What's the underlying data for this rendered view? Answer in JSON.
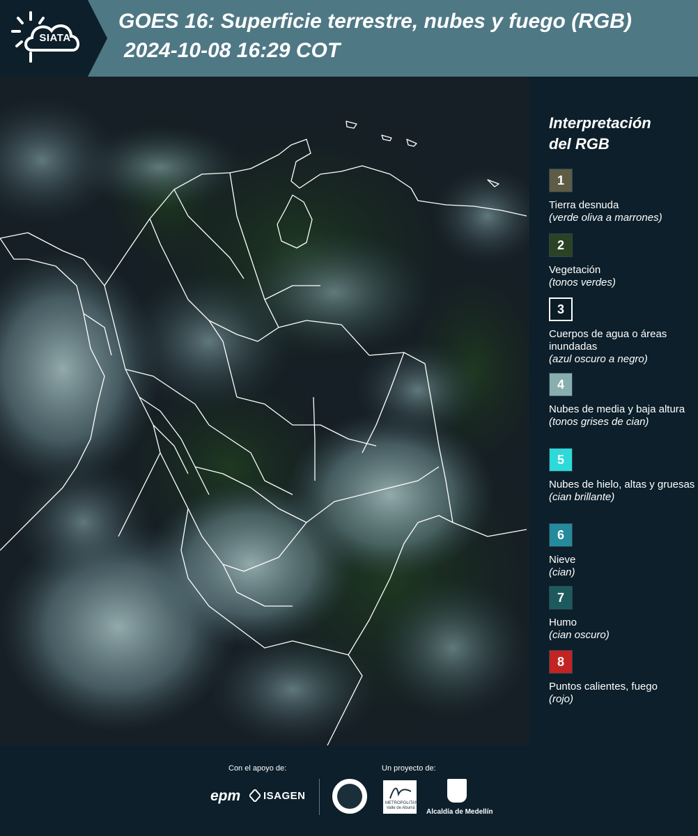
{
  "header": {
    "title_line1": "GOES 16: Superficie terrestre, nubes y fuego (RGB)",
    "title_line2": "2024-10-08 16:29 COT",
    "logo_text": "SIATA"
  },
  "legend": {
    "title_line1": "Interpretación",
    "title_line2": "del RGB",
    "items": [
      {
        "number": "1",
        "color": "#5e5c45",
        "name": "Tierra desnuda",
        "desc": "(verde oliva a marrones)"
      },
      {
        "number": "2",
        "color": "#2b4224",
        "name": "Vegetación",
        "desc": "(tonos verdes)"
      },
      {
        "number": "3",
        "color": "#0c1c26",
        "outlined": true,
        "name": "Cuerpos de agua o áreas inundadas",
        "desc": "(azul oscuro a negro)"
      },
      {
        "number": "4",
        "color": "#88aeaf",
        "name": "Nubes de media y baja altura",
        "desc": "(tonos grises de cian)"
      },
      {
        "number": "5",
        "color": "#2ed9d9",
        "name": "Nubes de hielo, altas y gruesas",
        "desc": "(cian brillante)"
      },
      {
        "number": "6",
        "color": "#248a9c",
        "name": "Nieve",
        "desc": "(cian)"
      },
      {
        "number": "7",
        "color": "#1d5a5d",
        "name": "Humo",
        "desc": "(cian oscuro)"
      },
      {
        "number": "8",
        "color": "#c42323",
        "name": "Puntos calientes, fuego",
        "desc": "(rojo)"
      }
    ]
  },
  "footer": {
    "support_label": "Con el apoyo de:",
    "project_label": "Un proyecto de:",
    "sponsor_epm": "epm",
    "sponsor_isagen": "ISAGEN",
    "partner_amva": "METROPOLITANA Valle de Aburrá",
    "partner_alcaldia": "Alcaldía de Medellín"
  },
  "colors": {
    "header_bg": "#4f7885",
    "logo_bg": "#0c1f2a",
    "panel_bg": "#0c1f2a",
    "border_white": "#ffffff"
  }
}
